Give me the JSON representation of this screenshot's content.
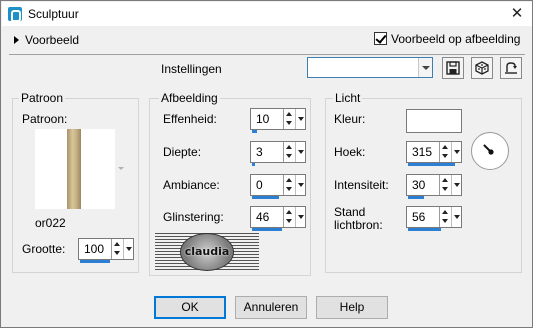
{
  "window": {
    "title": "Sculptuur"
  },
  "preview": {
    "label": "Voorbeeld",
    "on_image_label": "Voorbeeld op afbeelding",
    "on_image_checked": true
  },
  "settings": {
    "label": "Instellingen",
    "preset_value": ""
  },
  "toolbar": {
    "icons": [
      "save-icon",
      "randomize-icon",
      "reset-icon"
    ]
  },
  "pattern_group": {
    "title": "Patroon",
    "pattern_label": "Patroon:",
    "pattern_name": "or022",
    "size_label": "Grootte:",
    "size_value": "100",
    "size_fraction": 0.55
  },
  "image_group": {
    "title": "Afbeelding",
    "fields": [
      {
        "label": "Effenheid:",
        "value": "10",
        "fraction": 0.1
      },
      {
        "label": "Diepte:",
        "value": "3",
        "fraction": 0.0
      },
      {
        "label": "Ambiance:",
        "value": "0",
        "fraction": 0.5
      },
      {
        "label": "Glinstering:",
        "value": "46",
        "fraction": 0.55
      }
    ]
  },
  "light_group": {
    "title": "Licht",
    "color_label": "Kleur:",
    "color_value": "#ffffff",
    "angle_label": "Hoek:",
    "angle_value": "315",
    "angle_fraction": 0.875,
    "intensity_label": "Intensiteit:",
    "intensity_value": "30",
    "intensity_fraction": 0.3,
    "elevation_label_1": "Stand",
    "elevation_label_2": "lichtbron:",
    "elevation_value": "56",
    "elevation_fraction": 0.62
  },
  "watermark": {
    "text": "claudia"
  },
  "buttons": {
    "ok": "OK",
    "cancel": "Annuleren",
    "help": "Help"
  },
  "colors": {
    "accent": "#2d7fd3",
    "window_bg": "#f0f0f0",
    "focus_border": "#0078d7"
  }
}
